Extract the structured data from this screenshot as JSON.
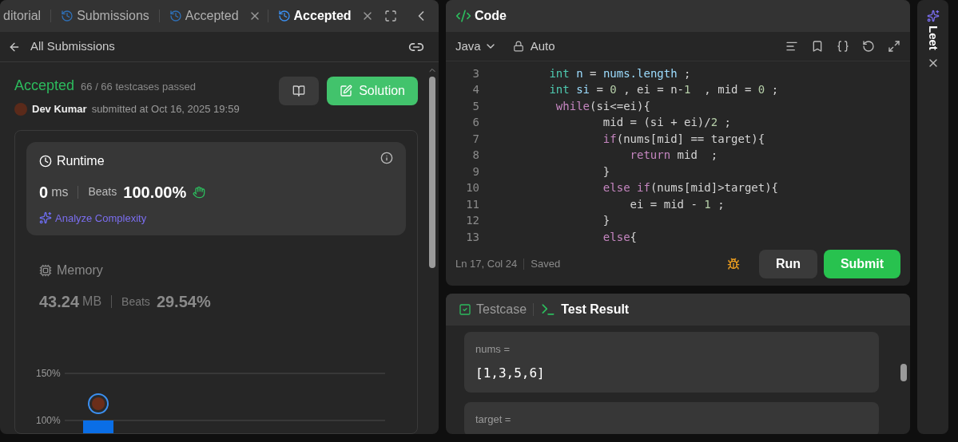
{
  "left_panel": {
    "tabs": [
      {
        "label": "ditorial",
        "kind": "plain",
        "closable": false,
        "selected": false
      },
      {
        "label": "Submissions",
        "kind": "history",
        "closable": false,
        "selected": false
      },
      {
        "label": "Accepted",
        "kind": "history",
        "closable": true,
        "selected": false
      },
      {
        "label": "Accepted",
        "kind": "history",
        "closable": true,
        "selected": true
      }
    ],
    "back_link": "All Submissions",
    "submission": {
      "status": "Accepted",
      "testcases": "66 / 66 testcases passed",
      "user": "Dev Kumar",
      "submitted": "submitted at Oct 16, 2025 19:59",
      "solution_button": "Solution"
    },
    "metrics": [
      {
        "kind": "runtime",
        "title": "Runtime",
        "value": "0",
        "unit": "ms",
        "beats_label": "Beats",
        "beats": "100.00%",
        "selected": true,
        "link": "Analyze Complexity"
      },
      {
        "kind": "memory",
        "title": "Memory",
        "value": "43.24",
        "unit": "MB",
        "beats_label": "Beats",
        "beats": "29.54%",
        "selected": false
      }
    ],
    "chart_data": {
      "type": "bar",
      "values": [
        100
      ],
      "ylim": [
        67,
        150
      ],
      "yticks": [
        {
          "value": 100,
          "label": "100%"
        },
        {
          "value": 150,
          "label": "150%"
        }
      ]
    }
  },
  "code_panel": {
    "title": "Code",
    "language": "Java",
    "mode": "Auto",
    "lines": [
      {
        "number": "3",
        "tokens": [
          {
            "text": "        int",
            "kind": "type"
          },
          {
            "text": " n",
            "kind": "var"
          },
          {
            "text": " = ",
            "kind": "plain"
          },
          {
            "text": "nums.length",
            "kind": "var"
          },
          {
            "text": " ;",
            "kind": "plain"
          }
        ]
      },
      {
        "number": "4",
        "tokens": [
          {
            "text": "        int",
            "kind": "type"
          },
          {
            "text": " si",
            "kind": "var"
          },
          {
            "text": " = ",
            "kind": "plain"
          },
          {
            "text": "0",
            "kind": "number"
          },
          {
            "text": " , ei = n-",
            "kind": "plain"
          },
          {
            "text": "1",
            "kind": "number"
          },
          {
            "text": "  , mid = ",
            "kind": "plain"
          },
          {
            "text": "0",
            "kind": "number"
          },
          {
            "text": " ;",
            "kind": "plain"
          }
        ]
      },
      {
        "number": "5",
        "tokens": [
          {
            "text": "         while",
            "kind": "keyword"
          },
          {
            "text": "(si<=ei){",
            "kind": "plain"
          }
        ]
      },
      {
        "number": "6",
        "tokens": [
          {
            "text": "                mid = (si + ei)/",
            "kind": "plain"
          },
          {
            "text": "2",
            "kind": "number"
          },
          {
            "text": " ;",
            "kind": "plain"
          }
        ]
      },
      {
        "number": "7",
        "tokens": [
          {
            "text": "                if",
            "kind": "keyword"
          },
          {
            "text": "(nums[mid] == target){",
            "kind": "plain"
          }
        ]
      },
      {
        "number": "8",
        "tokens": [
          {
            "text": "                    return",
            "kind": "keyword"
          },
          {
            "text": " mid  ;",
            "kind": "plain"
          }
        ]
      },
      {
        "number": "9",
        "tokens": [
          {
            "text": "                }",
            "kind": "plain"
          }
        ]
      },
      {
        "number": "10",
        "tokens": [
          {
            "text": "                else if",
            "kind": "keyword"
          },
          {
            "text": "(nums[mid]>target){",
            "kind": "plain"
          }
        ]
      },
      {
        "number": "11",
        "tokens": [
          {
            "text": "                    ei = mid - ",
            "kind": "plain"
          },
          {
            "text": "1",
            "kind": "number"
          },
          {
            "text": " ;",
            "kind": "plain"
          }
        ]
      },
      {
        "number": "12",
        "tokens": [
          {
            "text": "                }",
            "kind": "plain"
          }
        ]
      },
      {
        "number": "13",
        "tokens": [
          {
            "text": "                else",
            "kind": "keyword"
          },
          {
            "text": "{",
            "kind": "plain"
          }
        ]
      }
    ],
    "cursor": "Ln 17, Col 24",
    "save_state": "Saved",
    "run_button": "Run",
    "submit_button": "Submit"
  },
  "test_panel": {
    "tabs": [
      {
        "label": "Testcase",
        "kind": "testcase",
        "selected": false
      },
      {
        "label": "Test Result",
        "kind": "result",
        "selected": true
      }
    ],
    "inputs": [
      {
        "label": "nums =",
        "value": "[1,3,5,6]"
      },
      {
        "label": "target ="
      }
    ]
  },
  "side_rail": {
    "label": "Leet"
  }
}
